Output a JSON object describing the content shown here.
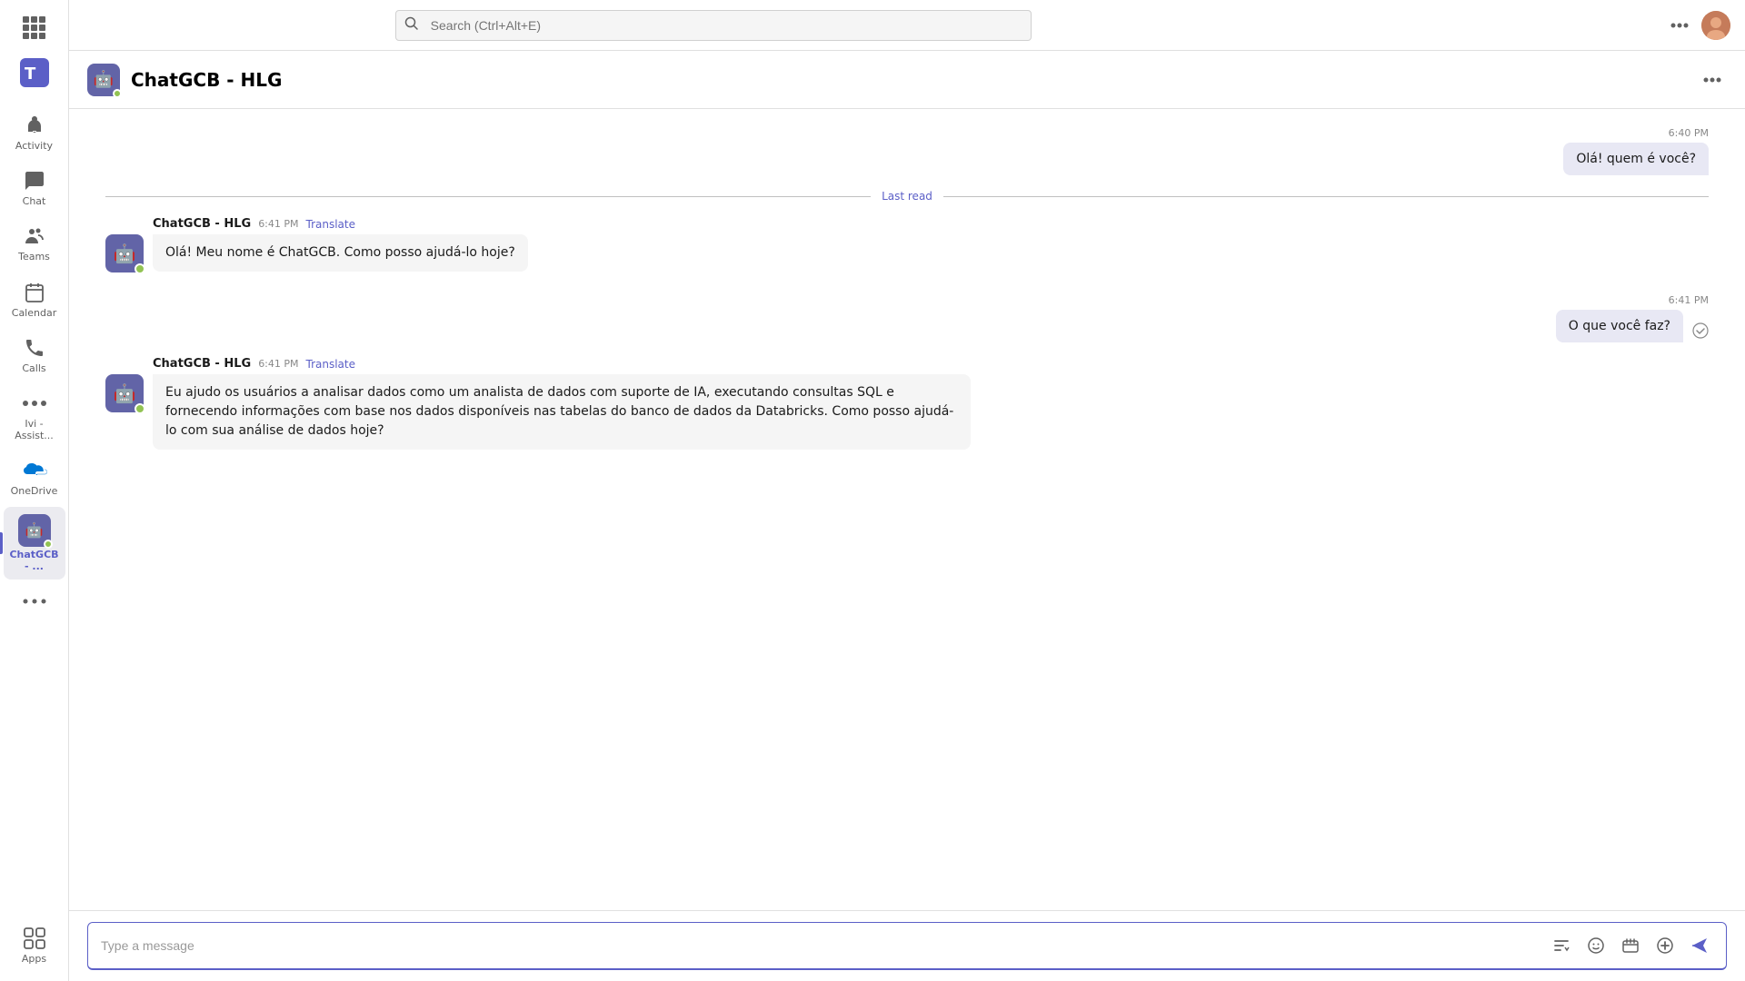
{
  "sidebar": {
    "logo_label": "Microsoft Teams",
    "items": [
      {
        "id": "grid",
        "label": "",
        "icon": "⊞",
        "active": false
      },
      {
        "id": "activity",
        "label": "Activity",
        "icon": "🔔",
        "active": false
      },
      {
        "id": "chat",
        "label": "Chat",
        "icon": "💬",
        "active": false
      },
      {
        "id": "teams",
        "label": "Teams",
        "icon": "👥",
        "active": false
      },
      {
        "id": "calendar",
        "label": "Calendar",
        "icon": "📅",
        "active": false
      },
      {
        "id": "calls",
        "label": "Calls",
        "icon": "📞",
        "active": false
      },
      {
        "id": "assistant",
        "label": "Ivi - Assist...",
        "icon": "···",
        "active": false
      },
      {
        "id": "onedrive",
        "label": "OneDrive",
        "icon": "☁",
        "active": false
      },
      {
        "id": "chatgcb",
        "label": "ChatGCB - ...",
        "active": true
      },
      {
        "id": "more",
        "label": "···",
        "icon": "···",
        "active": false
      },
      {
        "id": "apps",
        "label": "Apps",
        "icon": "⊞",
        "active": false
      }
    ]
  },
  "topbar": {
    "search_placeholder": "Search (Ctrl+Alt+E)",
    "more_label": "···"
  },
  "chat_header": {
    "title": "ChatGCB - HLG",
    "more_label": "···"
  },
  "messages": [
    {
      "id": "msg1",
      "type": "outgoing",
      "time": "6:40 PM",
      "text": "Olá! quem é você?"
    },
    {
      "id": "divider",
      "type": "divider",
      "label": "Last read"
    },
    {
      "id": "msg2",
      "type": "incoming",
      "sender": "ChatGCB - HLG",
      "time": "6:41 PM",
      "translate": "Translate",
      "text": "Olá! Meu nome é ChatGCB. Como posso ajudá-lo hoje?"
    },
    {
      "id": "msg3",
      "type": "outgoing",
      "time": "6:41 PM",
      "text": "O que você faz?",
      "delivered": true
    },
    {
      "id": "msg4",
      "type": "incoming",
      "sender": "ChatGCB - HLG",
      "time": "6:41 PM",
      "translate": "Translate",
      "text": "Eu ajudo os usuários a analisar dados como um analista de dados com suporte de IA, executando consultas SQL e fornecendo informações com base nos dados disponíveis nas tabelas do banco de dados da Databricks. Como posso ajudá-lo com sua análise de dados hoje?"
    }
  ],
  "message_input": {
    "placeholder": "Type a message"
  }
}
